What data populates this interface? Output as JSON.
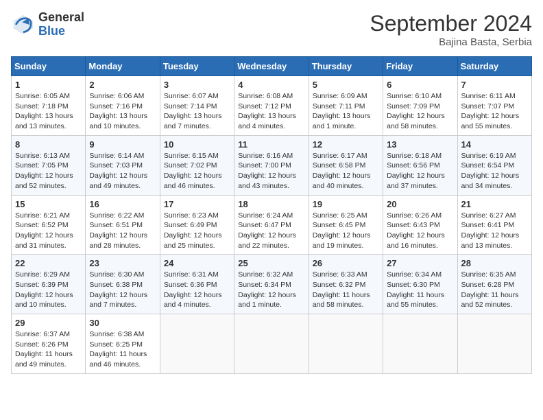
{
  "header": {
    "logo_general": "General",
    "logo_blue": "Blue",
    "month_title": "September 2024",
    "subtitle": "Bajina Basta, Serbia"
  },
  "weekdays": [
    "Sunday",
    "Monday",
    "Tuesday",
    "Wednesday",
    "Thursday",
    "Friday",
    "Saturday"
  ],
  "weeks": [
    [
      {
        "day": "1",
        "info": "Sunrise: 6:05 AM\nSunset: 7:18 PM\nDaylight: 13 hours\nand 13 minutes."
      },
      {
        "day": "2",
        "info": "Sunrise: 6:06 AM\nSunset: 7:16 PM\nDaylight: 13 hours\nand 10 minutes."
      },
      {
        "day": "3",
        "info": "Sunrise: 6:07 AM\nSunset: 7:14 PM\nDaylight: 13 hours\nand 7 minutes."
      },
      {
        "day": "4",
        "info": "Sunrise: 6:08 AM\nSunset: 7:12 PM\nDaylight: 13 hours\nand 4 minutes."
      },
      {
        "day": "5",
        "info": "Sunrise: 6:09 AM\nSunset: 7:11 PM\nDaylight: 13 hours\nand 1 minute."
      },
      {
        "day": "6",
        "info": "Sunrise: 6:10 AM\nSunset: 7:09 PM\nDaylight: 12 hours\nand 58 minutes."
      },
      {
        "day": "7",
        "info": "Sunrise: 6:11 AM\nSunset: 7:07 PM\nDaylight: 12 hours\nand 55 minutes."
      }
    ],
    [
      {
        "day": "8",
        "info": "Sunrise: 6:13 AM\nSunset: 7:05 PM\nDaylight: 12 hours\nand 52 minutes."
      },
      {
        "day": "9",
        "info": "Sunrise: 6:14 AM\nSunset: 7:03 PM\nDaylight: 12 hours\nand 49 minutes."
      },
      {
        "day": "10",
        "info": "Sunrise: 6:15 AM\nSunset: 7:02 PM\nDaylight: 12 hours\nand 46 minutes."
      },
      {
        "day": "11",
        "info": "Sunrise: 6:16 AM\nSunset: 7:00 PM\nDaylight: 12 hours\nand 43 minutes."
      },
      {
        "day": "12",
        "info": "Sunrise: 6:17 AM\nSunset: 6:58 PM\nDaylight: 12 hours\nand 40 minutes."
      },
      {
        "day": "13",
        "info": "Sunrise: 6:18 AM\nSunset: 6:56 PM\nDaylight: 12 hours\nand 37 minutes."
      },
      {
        "day": "14",
        "info": "Sunrise: 6:19 AM\nSunset: 6:54 PM\nDaylight: 12 hours\nand 34 minutes."
      }
    ],
    [
      {
        "day": "15",
        "info": "Sunrise: 6:21 AM\nSunset: 6:52 PM\nDaylight: 12 hours\nand 31 minutes."
      },
      {
        "day": "16",
        "info": "Sunrise: 6:22 AM\nSunset: 6:51 PM\nDaylight: 12 hours\nand 28 minutes."
      },
      {
        "day": "17",
        "info": "Sunrise: 6:23 AM\nSunset: 6:49 PM\nDaylight: 12 hours\nand 25 minutes."
      },
      {
        "day": "18",
        "info": "Sunrise: 6:24 AM\nSunset: 6:47 PM\nDaylight: 12 hours\nand 22 minutes."
      },
      {
        "day": "19",
        "info": "Sunrise: 6:25 AM\nSunset: 6:45 PM\nDaylight: 12 hours\nand 19 minutes."
      },
      {
        "day": "20",
        "info": "Sunrise: 6:26 AM\nSunset: 6:43 PM\nDaylight: 12 hours\nand 16 minutes."
      },
      {
        "day": "21",
        "info": "Sunrise: 6:27 AM\nSunset: 6:41 PM\nDaylight: 12 hours\nand 13 minutes."
      }
    ],
    [
      {
        "day": "22",
        "info": "Sunrise: 6:29 AM\nSunset: 6:39 PM\nDaylight: 12 hours\nand 10 minutes."
      },
      {
        "day": "23",
        "info": "Sunrise: 6:30 AM\nSunset: 6:38 PM\nDaylight: 12 hours\nand 7 minutes."
      },
      {
        "day": "24",
        "info": "Sunrise: 6:31 AM\nSunset: 6:36 PM\nDaylight: 12 hours\nand 4 minutes."
      },
      {
        "day": "25",
        "info": "Sunrise: 6:32 AM\nSunset: 6:34 PM\nDaylight: 12 hours\nand 1 minute."
      },
      {
        "day": "26",
        "info": "Sunrise: 6:33 AM\nSunset: 6:32 PM\nDaylight: 11 hours\nand 58 minutes."
      },
      {
        "day": "27",
        "info": "Sunrise: 6:34 AM\nSunset: 6:30 PM\nDaylight: 11 hours\nand 55 minutes."
      },
      {
        "day": "28",
        "info": "Sunrise: 6:35 AM\nSunset: 6:28 PM\nDaylight: 11 hours\nand 52 minutes."
      }
    ],
    [
      {
        "day": "29",
        "info": "Sunrise: 6:37 AM\nSunset: 6:26 PM\nDaylight: 11 hours\nand 49 minutes."
      },
      {
        "day": "30",
        "info": "Sunrise: 6:38 AM\nSunset: 6:25 PM\nDaylight: 11 hours\nand 46 minutes."
      },
      {
        "day": "",
        "info": ""
      },
      {
        "day": "",
        "info": ""
      },
      {
        "day": "",
        "info": ""
      },
      {
        "day": "",
        "info": ""
      },
      {
        "day": "",
        "info": ""
      }
    ]
  ]
}
